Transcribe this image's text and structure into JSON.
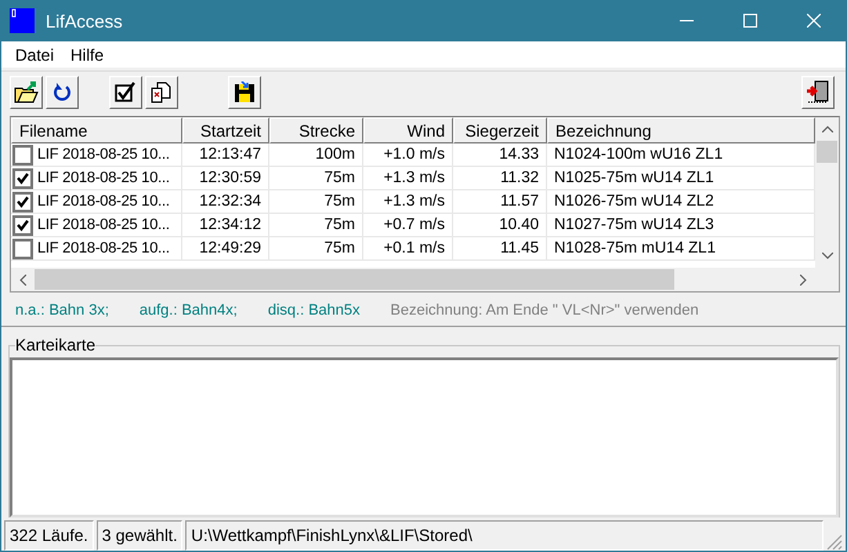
{
  "window": {
    "title": "LifAccess"
  },
  "menu": [
    "Datei",
    "Hilfe"
  ],
  "table": {
    "columns": [
      "Filename",
      "Startzeit",
      "Strecke",
      "Wind",
      "Siegerzeit",
      "Bezeichnung"
    ],
    "rows": [
      {
        "checked": false,
        "cells": [
          "LIF 2018-08-25 10...",
          "12:13:47",
          "100m",
          "+1.0 m/s",
          "14.33",
          "N1024-100m wU16 ZL1"
        ]
      },
      {
        "checked": true,
        "cells": [
          "LIF 2018-08-25 10...",
          "12:30:59",
          "75m",
          "+1.3 m/s",
          "11.32",
          "N1025-75m wU14 ZL1"
        ]
      },
      {
        "checked": true,
        "cells": [
          "LIF 2018-08-25 10...",
          "12:32:34",
          "75m",
          "+1.3 m/s",
          "11.57",
          "N1026-75m wU14 ZL2"
        ]
      },
      {
        "checked": true,
        "cells": [
          "LIF 2018-08-25 10...",
          "12:34:12",
          "75m",
          "+0.7 m/s",
          "10.40",
          "N1027-75m wU14 ZL3"
        ]
      },
      {
        "checked": false,
        "cells": [
          "LIF 2018-08-25 10...",
          "12:49:29",
          "75m",
          "+0.1 m/s",
          "11.45",
          "N1028-75m mU14 ZL1"
        ]
      }
    ]
  },
  "legend": [
    {
      "text": "n.a.: Bahn 3x;",
      "kind": "code"
    },
    {
      "text": "aufg.: Bahn4x;",
      "kind": "code"
    },
    {
      "text": "disq.: Bahn5x",
      "kind": "code"
    },
    {
      "text": "Bezeichnung: Am Ende \" VL<Nr>\" verwenden",
      "kind": "hint"
    }
  ],
  "card": {
    "title": "Karteikarte"
  },
  "status_bar": [
    "322 Läufe.",
    "3 gewählt.",
    "U:\\Wettkampf\\FinishLynx\\&LIF\\Stored\\"
  ]
}
